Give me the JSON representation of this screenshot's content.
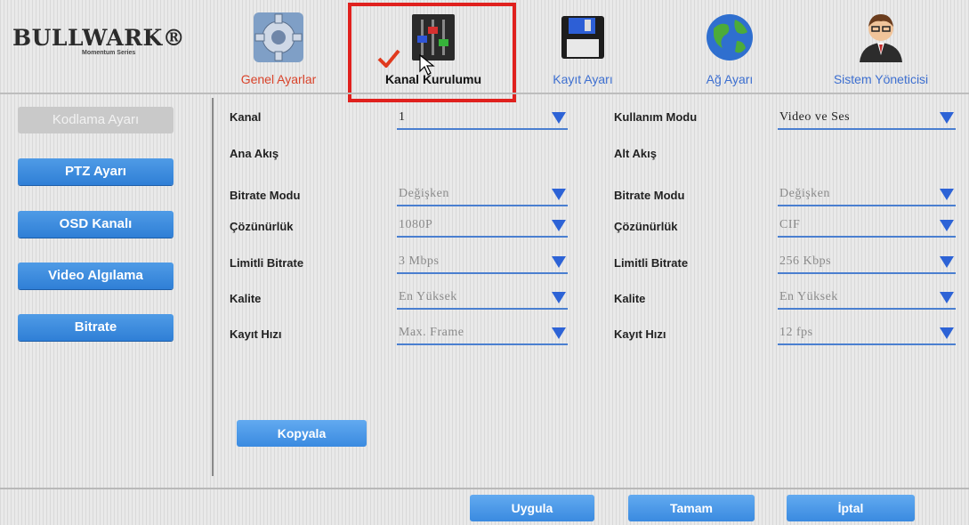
{
  "logo": {
    "name": "BULLWARK®",
    "sub": "Momentum Series"
  },
  "tabs": [
    {
      "label": "Genel Ayarlar",
      "icon": "gear-icon"
    },
    {
      "label": "Kanal Kurulumu",
      "icon": "mixer-sliders-icon"
    },
    {
      "label": "Kayıt Ayarı",
      "icon": "floppy-disk-icon"
    },
    {
      "label": "Ağ Ayarı",
      "icon": "globe-icon"
    },
    {
      "label": "Sistem Yöneticisi",
      "icon": "admin-user-icon"
    }
  ],
  "sidebar": [
    "Kodlama Ayarı",
    "PTZ Ayarı",
    "OSD Kanalı",
    "Video Algılama",
    "Bitrate"
  ],
  "form": {
    "kanal_label": "Kanal",
    "kanal_value": "1",
    "kullanim_label": "Kullanım Modu",
    "kullanim_value": "Video ve Ses",
    "ana_akis": "Ana Akış",
    "alt_akis": "Alt Akış",
    "left": [
      {
        "label": "Bitrate Modu",
        "value": "Değişken"
      },
      {
        "label": "Çözünürlük",
        "value": "1080P"
      },
      {
        "label": "Limitli Bitrate",
        "value": "3 Mbps"
      },
      {
        "label": "Kalite",
        "value": "En Yüksek"
      },
      {
        "label": "Kayıt Hızı",
        "value": "Max. Frame"
      }
    ],
    "right": [
      {
        "label": "Bitrate Modu",
        "value": "Değişken"
      },
      {
        "label": "Çözünürlük",
        "value": "CIF"
      },
      {
        "label": "Limitli Bitrate",
        "value": "256 Kbps"
      },
      {
        "label": "Kalite",
        "value": "En Yüksek"
      },
      {
        "label": "Kayıt Hızı",
        "value": "12 fps"
      }
    ]
  },
  "buttons": {
    "kopyala": "Kopyala",
    "uygula": "Uygula",
    "tamam": "Tamam",
    "iptal": "İptal"
  },
  "colors": {
    "accent": "#3a8ae0",
    "highlight": "#e0211e",
    "selected_tab": "#d9432a"
  }
}
